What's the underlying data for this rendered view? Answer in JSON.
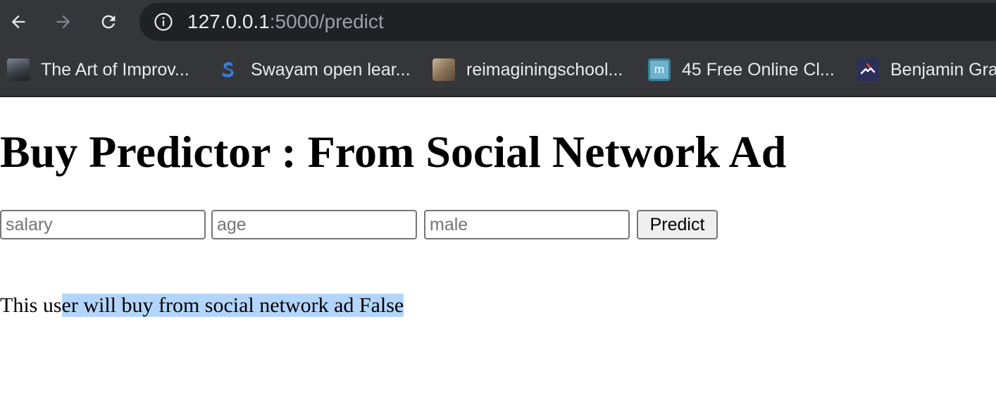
{
  "browser": {
    "url_host": "127.0.0.1",
    "url_path": ":5000/predict",
    "bookmarks": [
      {
        "label": "The Art of Improv...",
        "icon": "art-of-improv-favicon"
      },
      {
        "label": "Swayam open lear...",
        "icon": "swayam-favicon"
      },
      {
        "label": "reimaginingschool...",
        "icon": "reimaginingschool-favicon"
      },
      {
        "label": "45 Free Online Cl...",
        "icon": "mooc-favicon",
        "icon_text": "m"
      },
      {
        "label": "Benjamin Gra",
        "icon": "benjamin-favicon"
      }
    ]
  },
  "page": {
    "title": "Buy Predictor : From Social Network Ad",
    "form": {
      "salary_placeholder": "salary",
      "age_placeholder": "age",
      "male_placeholder": "male",
      "predict_label": "Predict"
    },
    "result": {
      "unselected": "This us",
      "selected": "er will buy from social network ad False"
    }
  },
  "colors": {
    "chrome_bg": "#35363a",
    "omnibox_bg": "#202124",
    "selection": "#b4d5fb"
  }
}
